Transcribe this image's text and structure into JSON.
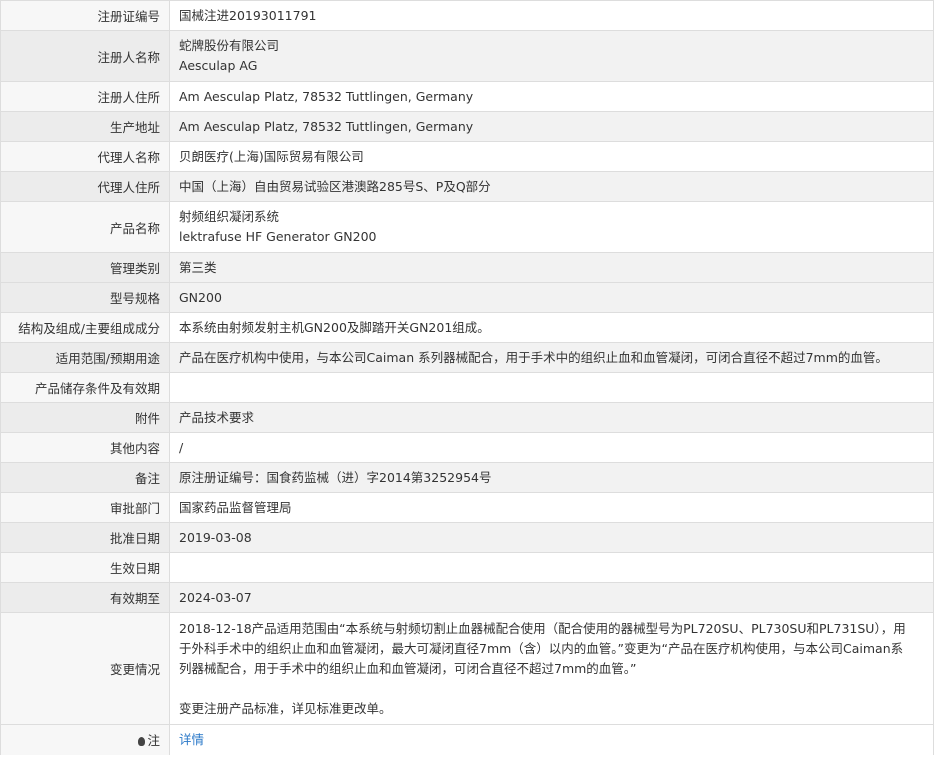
{
  "rows": [
    {
      "label": "注册证编号",
      "value": "国械注进20193011791"
    },
    {
      "label": "注册人名称",
      "line1": "蛇牌股份有限公司",
      "line2": "Aesculap AG"
    },
    {
      "label": "注册人住所",
      "value": "Am Aesculap Platz, 78532 Tuttlingen, Germany"
    },
    {
      "label": "生产地址",
      "value": "Am Aesculap Platz, 78532 Tuttlingen, Germany"
    },
    {
      "label": "代理人名称",
      "value": "贝朗医疗(上海)国际贸易有限公司"
    },
    {
      "label": "代理人住所",
      "value": "中国（上海）自由贸易试验区港澳路285号S、P及Q部分"
    },
    {
      "label": "产品名称",
      "line1": "射频组织凝闭系统",
      "line2": "lektrafuse HF Generator GN200"
    },
    {
      "label": "管理类别",
      "value": "第三类"
    },
    {
      "label": "型号规格",
      "value": "GN200"
    },
    {
      "label": "结构及组成/主要组成成分",
      "value": "本系统由射频发射主机GN200及脚踏开关GN201组成。"
    },
    {
      "label": "适用范围/预期用途",
      "value": "产品在医疗机构中使用，与本公司Caiman 系列器械配合，用于手术中的组织止血和血管凝闭，可闭合直径不超过7mm的血管。"
    },
    {
      "label": "产品储存条件及有效期",
      "value": ""
    },
    {
      "label": "附件",
      "value": "产品技术要求"
    },
    {
      "label": "其他内容",
      "value": "/"
    },
    {
      "label": "备注",
      "value": "原注册证编号：国食药监械（进）字2014第3252954号"
    },
    {
      "label": "审批部门",
      "value": "国家药品监督管理局"
    },
    {
      "label": "批准日期",
      "value": "2019-03-08"
    },
    {
      "label": "生效日期",
      "value": ""
    },
    {
      "label": "有效期至",
      "value": "2024-03-07"
    },
    {
      "label": "变更情况",
      "line1": "2018-12-18产品适用范围由“本系统与射频切割止血器械配合使用（配合使用的器械型号为PL720SU、PL730SU和PL731SU），用",
      "line2": "于外科手术中的组织止血和血管凝闭，最大可凝闭直径7mm（含）以内的血管。”变更为“产品在医疗机构使用，与本公司Caiman系",
      "line3": "列器械配合，用于手术中的组织止血和血管凝闭，可闭合直径不超过7mm的血管。”",
      "line4": "变更注册产品标准，详见标准更改单。"
    },
    {
      "label": "注",
      "value": "详情"
    }
  ]
}
